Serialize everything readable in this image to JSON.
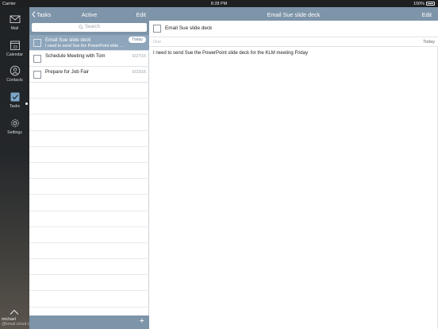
{
  "status_bar": {
    "carrier": "Carrier",
    "time": "8:28 PM",
    "battery": "100%"
  },
  "sidebar": {
    "items": [
      {
        "label": "Mail",
        "icon": "mail-icon"
      },
      {
        "label": "Calendar",
        "icon": "calendar-icon",
        "day": "23"
      },
      {
        "label": "Contacts",
        "icon": "contacts-icon"
      },
      {
        "label": "Tasks",
        "icon": "tasks-icon",
        "active": true
      },
      {
        "label": "Settings",
        "icon": "gear-icon"
      }
    ],
    "user_name": "michael",
    "user_email": "@kmail.cloud.co"
  },
  "list": {
    "back_label": "Tasks",
    "title": "Active",
    "edit_label": "Edit",
    "search_placeholder": "Search",
    "tasks": [
      {
        "title": "Email Sue slide deck",
        "note": "I need to send Sue the PowerPoint slide d...",
        "date": "Today",
        "selected": true
      },
      {
        "title": "Schedule Meeting with Tom",
        "note": "",
        "date": "6/27/16",
        "selected": false
      },
      {
        "title": "Prepare for Job Fair",
        "note": "",
        "date": "6/23/16",
        "selected": false
      }
    ],
    "add_label": "+"
  },
  "detail": {
    "title": "Email Sue slide deck",
    "edit_label": "Edit",
    "task_title": "Email Sue slide deck",
    "due_label": "Due",
    "due_value": "Today",
    "notes": "I need to send Sue the PowerPoint slide deck for the KLM meeting Friday"
  },
  "colors": {
    "accent_bar": "#7d94a9",
    "selected_row": "#8ea6bc",
    "sidebar_dark": "#1f2224"
  }
}
